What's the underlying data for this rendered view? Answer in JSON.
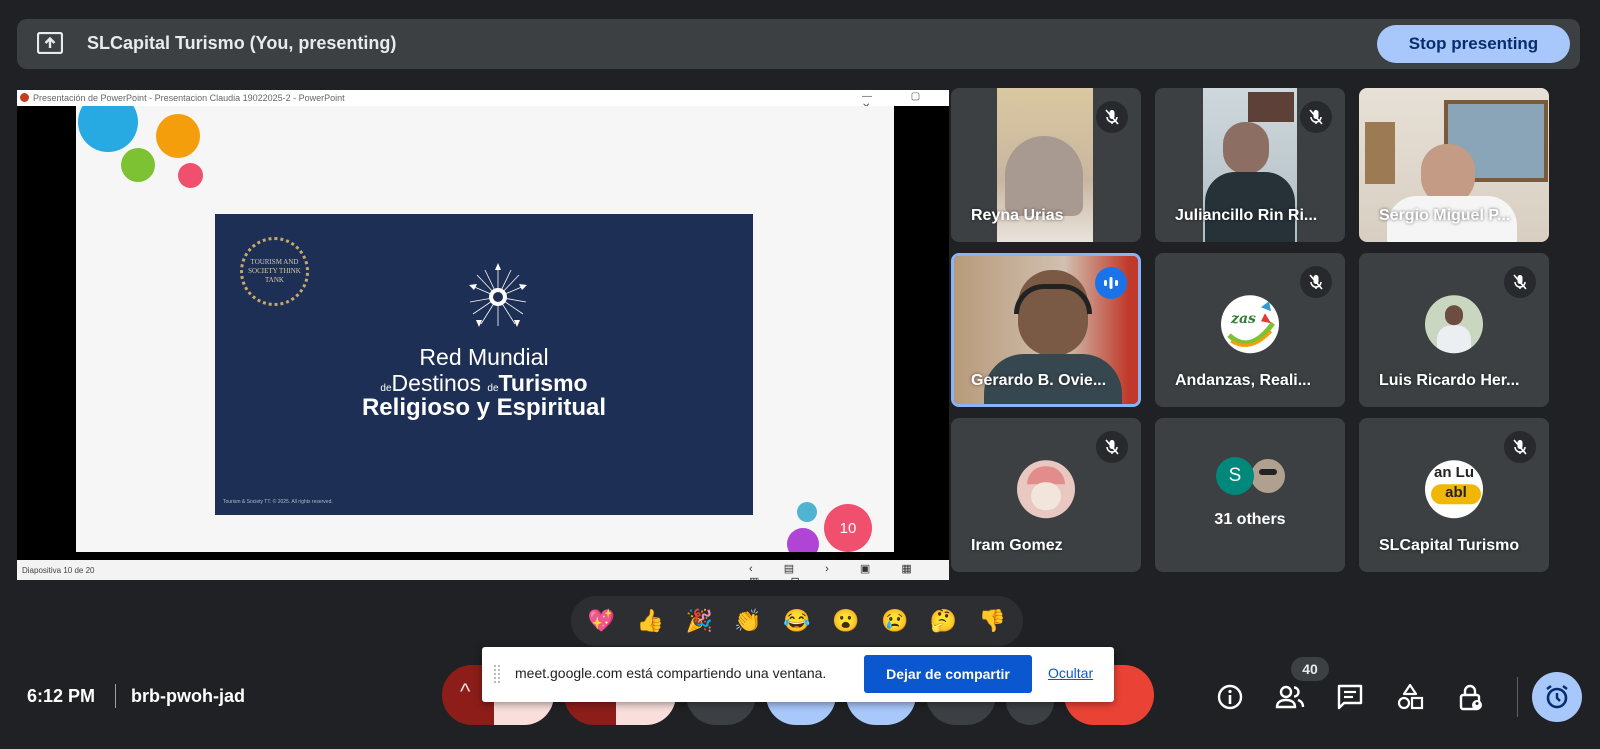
{
  "topbar": {
    "title": "SLCapital Turismo (You, presenting)",
    "stop_label": "Stop presenting"
  },
  "ppt": {
    "window_title": "Presentación de PowerPoint - Presentacion Claudia 19022025-2 - PowerPoint",
    "window_controls": "— ▢ ✕",
    "slide_status": "Diapositiva 10 de 20",
    "badge_text": "TOURISM AND SOCIETY THINK TANK",
    "slide_line1": "Red Mundial",
    "slide_line2_de1": "de",
    "slide_line2_destinos": "Destinos",
    "slide_line2_de2": "de",
    "slide_line2_turismo": "Turismo",
    "slide_line3": "Religioso y Espiritual",
    "slide_copyright": "Tourism & Society TT. © 2025. All rights reserved.",
    "slide_badge_number": "10",
    "nav_glyphs": "‹ ▤ › ▣ ▦ ▥ ⊟"
  },
  "participants": [
    {
      "name": "Reyna Urias",
      "muted": true
    },
    {
      "name": "Juliancillo Rin Ri...",
      "muted": true
    },
    {
      "name": "Sergio Miguel P...",
      "muted": true
    },
    {
      "name": "Gerardo B. Ovie...",
      "speaking": true
    },
    {
      "name": "Andanzas, Reali...",
      "muted": true
    },
    {
      "name": "Luis Ricardo Her...",
      "muted": true
    },
    {
      "name": "Iram Gomez",
      "muted": true
    },
    {
      "name": "31 others",
      "avatar_letter": "S"
    },
    {
      "name": "SLCapital Turismo",
      "muted": true
    }
  ],
  "reactions": [
    "💖",
    "👍",
    "🎉",
    "👏",
    "😂",
    "😮",
    "😢",
    "🤔",
    "👎"
  ],
  "bottom": {
    "time": "6:12 PM",
    "meeting_code": "brb-pwoh-jad",
    "participant_count": "40"
  },
  "share_banner": {
    "message": "meet.google.com está compartiendo una ventana.",
    "stop_label": "Dejar de compartir",
    "hide_label": "Ocultar"
  },
  "colors": {
    "background": "#202124",
    "tile": "#3c4043",
    "accent": "#a8c7fa",
    "end_call": "#ea4335",
    "banner_button": "#0b57d0"
  }
}
